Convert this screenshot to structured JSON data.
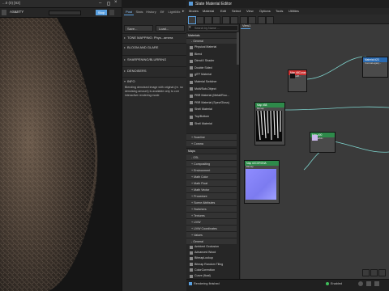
{
  "render_window": {
    "title": "...0 (0) [83]",
    "toolbar_label": "AS&IITY",
    "icons": [
      "save-icon",
      "copy-icon",
      "clear-icon",
      "print-icon"
    ]
  },
  "settings_panel": {
    "tabs": [
      "Post",
      "Stats",
      "History",
      "Eff",
      "LightMix"
    ],
    "buttons": [
      "Save...",
      "Load..."
    ],
    "sections": [
      {
        "label": "TONE MAPPING: Phys...amera",
        "open": false
      },
      {
        "label": "BLOOM AND GLARE",
        "open": false
      },
      {
        "label": "SHARPENING/BLURRING",
        "open": false
      },
      {
        "label": "DENOISERS",
        "open": false
      },
      {
        "label": "INFO",
        "open": true
      }
    ],
    "info_text": "Blending denoised image with original (re. no denoising amount) is available only to corr interactive rendering mode"
  },
  "slate": {
    "title": "Slate Material Editor",
    "menu": [
      "Modes",
      "Material",
      "Edit",
      "Select",
      "View",
      "Options",
      "Tools",
      "Utilities"
    ],
    "view_tab": "View1",
    "search_placeholder": "Search by Name ...",
    "browser": {
      "materials_header": "Materials",
      "general_header": "- General",
      "materials": [
        "Physical Material",
        "Blend",
        "DirectX Shader",
        "Double Sided",
        "glTF Material",
        "Material Switcher",
        "Multi/Sub-Object",
        "PBR Material (Metal/Rou...",
        "PBR Material (Spec/Gloss)",
        "Shell Material",
        "Top/Bottom",
        "Shell Material"
      ],
      "scanline_header": "+ Scanline",
      "corona_header": "+ Corona",
      "maps_header": "Maps",
      "osl_header": "- OSL",
      "osl_groups": [
        "+ Compositing",
        "+ Environment",
        "+ Math Color",
        "+ Math Float",
        "+ Math Vector",
        "+ Procedure",
        "+ Scene Attributes",
        "+ Switchers",
        "+ Textures",
        "+ UVW",
        "+ UVW Coordinates",
        "+ Values"
      ],
      "general_maps_header": "- General",
      "maps": [
        "Ambient Occlusion",
        "Advanced Wood",
        "BitmapLookup",
        "Bitmap Random Tiling",
        "ColorCorrection",
        "Curve (float)",
        "Curves (color correction)",
        "Curves (color gradient)",
        "UV GammaGain",
        "Noise"
      ]
    },
    "nodes": [
      {
        "title": "Map #8Corona...",
        "sub": "CoronaB...",
        "color": "#c33"
      },
      {
        "title": "Material #23",
        "sub": "CoronaLegacy...",
        "color": "#2a6ab0"
      },
      {
        "title": "Map #58",
        "sub": "Bitmap",
        "color": "#2e8a4a"
      },
      {
        "title": "Map #00",
        "sub": "CoronaMix",
        "color": "#2e8a4a"
      },
      {
        "title": "Map #2CORONA",
        "sub": "Bitmap",
        "color": "#2e8a4a"
      }
    ],
    "status": "Rendering finished",
    "status_right": "Enabled"
  },
  "colors": {
    "accent": "#5aa0e0",
    "node_green": "#2e8a4a",
    "wire": "#7fd6d0"
  }
}
